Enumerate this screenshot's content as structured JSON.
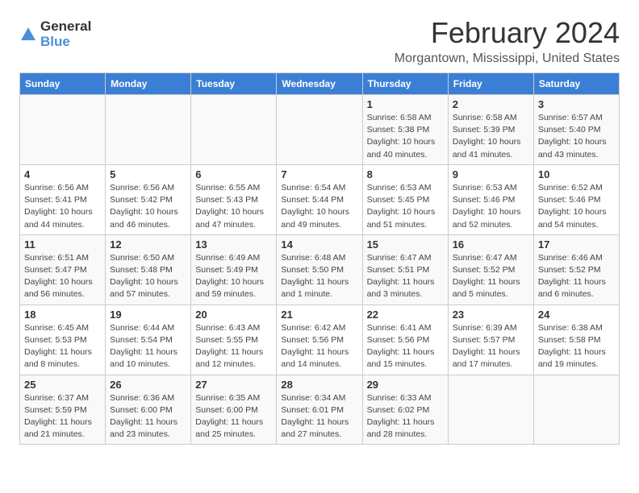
{
  "logo": {
    "general": "General",
    "blue": "Blue"
  },
  "title": "February 2024",
  "location": "Morgantown, Mississippi, United States",
  "days_header": [
    "Sunday",
    "Monday",
    "Tuesday",
    "Wednesday",
    "Thursday",
    "Friday",
    "Saturday"
  ],
  "weeks": [
    [
      {
        "num": "",
        "info": ""
      },
      {
        "num": "",
        "info": ""
      },
      {
        "num": "",
        "info": ""
      },
      {
        "num": "",
        "info": ""
      },
      {
        "num": "1",
        "info": "Sunrise: 6:58 AM\nSunset: 5:38 PM\nDaylight: 10 hours\nand 40 minutes."
      },
      {
        "num": "2",
        "info": "Sunrise: 6:58 AM\nSunset: 5:39 PM\nDaylight: 10 hours\nand 41 minutes."
      },
      {
        "num": "3",
        "info": "Sunrise: 6:57 AM\nSunset: 5:40 PM\nDaylight: 10 hours\nand 43 minutes."
      }
    ],
    [
      {
        "num": "4",
        "info": "Sunrise: 6:56 AM\nSunset: 5:41 PM\nDaylight: 10 hours\nand 44 minutes."
      },
      {
        "num": "5",
        "info": "Sunrise: 6:56 AM\nSunset: 5:42 PM\nDaylight: 10 hours\nand 46 minutes."
      },
      {
        "num": "6",
        "info": "Sunrise: 6:55 AM\nSunset: 5:43 PM\nDaylight: 10 hours\nand 47 minutes."
      },
      {
        "num": "7",
        "info": "Sunrise: 6:54 AM\nSunset: 5:44 PM\nDaylight: 10 hours\nand 49 minutes."
      },
      {
        "num": "8",
        "info": "Sunrise: 6:53 AM\nSunset: 5:45 PM\nDaylight: 10 hours\nand 51 minutes."
      },
      {
        "num": "9",
        "info": "Sunrise: 6:53 AM\nSunset: 5:46 PM\nDaylight: 10 hours\nand 52 minutes."
      },
      {
        "num": "10",
        "info": "Sunrise: 6:52 AM\nSunset: 5:46 PM\nDaylight: 10 hours\nand 54 minutes."
      }
    ],
    [
      {
        "num": "11",
        "info": "Sunrise: 6:51 AM\nSunset: 5:47 PM\nDaylight: 10 hours\nand 56 minutes."
      },
      {
        "num": "12",
        "info": "Sunrise: 6:50 AM\nSunset: 5:48 PM\nDaylight: 10 hours\nand 57 minutes."
      },
      {
        "num": "13",
        "info": "Sunrise: 6:49 AM\nSunset: 5:49 PM\nDaylight: 10 hours\nand 59 minutes."
      },
      {
        "num": "14",
        "info": "Sunrise: 6:48 AM\nSunset: 5:50 PM\nDaylight: 11 hours\nand 1 minute."
      },
      {
        "num": "15",
        "info": "Sunrise: 6:47 AM\nSunset: 5:51 PM\nDaylight: 11 hours\nand 3 minutes."
      },
      {
        "num": "16",
        "info": "Sunrise: 6:47 AM\nSunset: 5:52 PM\nDaylight: 11 hours\nand 5 minutes."
      },
      {
        "num": "17",
        "info": "Sunrise: 6:46 AM\nSunset: 5:52 PM\nDaylight: 11 hours\nand 6 minutes."
      }
    ],
    [
      {
        "num": "18",
        "info": "Sunrise: 6:45 AM\nSunset: 5:53 PM\nDaylight: 11 hours\nand 8 minutes."
      },
      {
        "num": "19",
        "info": "Sunrise: 6:44 AM\nSunset: 5:54 PM\nDaylight: 11 hours\nand 10 minutes."
      },
      {
        "num": "20",
        "info": "Sunrise: 6:43 AM\nSunset: 5:55 PM\nDaylight: 11 hours\nand 12 minutes."
      },
      {
        "num": "21",
        "info": "Sunrise: 6:42 AM\nSunset: 5:56 PM\nDaylight: 11 hours\nand 14 minutes."
      },
      {
        "num": "22",
        "info": "Sunrise: 6:41 AM\nSunset: 5:56 PM\nDaylight: 11 hours\nand 15 minutes."
      },
      {
        "num": "23",
        "info": "Sunrise: 6:39 AM\nSunset: 5:57 PM\nDaylight: 11 hours\nand 17 minutes."
      },
      {
        "num": "24",
        "info": "Sunrise: 6:38 AM\nSunset: 5:58 PM\nDaylight: 11 hours\nand 19 minutes."
      }
    ],
    [
      {
        "num": "25",
        "info": "Sunrise: 6:37 AM\nSunset: 5:59 PM\nDaylight: 11 hours\nand 21 minutes."
      },
      {
        "num": "26",
        "info": "Sunrise: 6:36 AM\nSunset: 6:00 PM\nDaylight: 11 hours\nand 23 minutes."
      },
      {
        "num": "27",
        "info": "Sunrise: 6:35 AM\nSunset: 6:00 PM\nDaylight: 11 hours\nand 25 minutes."
      },
      {
        "num": "28",
        "info": "Sunrise: 6:34 AM\nSunset: 6:01 PM\nDaylight: 11 hours\nand 27 minutes."
      },
      {
        "num": "29",
        "info": "Sunrise: 6:33 AM\nSunset: 6:02 PM\nDaylight: 11 hours\nand 28 minutes."
      },
      {
        "num": "",
        "info": ""
      },
      {
        "num": "",
        "info": ""
      }
    ]
  ]
}
